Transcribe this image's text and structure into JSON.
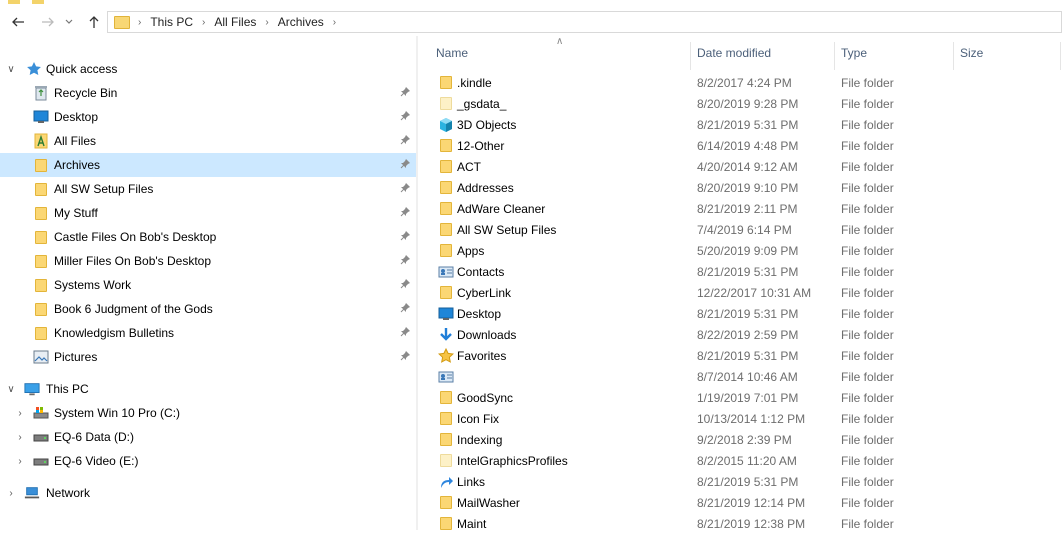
{
  "address": {
    "crumbs": [
      "This PC",
      "All Files",
      "Archives"
    ]
  },
  "nav": {
    "quick_access_label": "Quick access",
    "quick_items": [
      {
        "label": "Recycle Bin",
        "icon": "recycle-bin-icon"
      },
      {
        "label": "Desktop",
        "icon": "desktop-icon"
      },
      {
        "label": "All Files",
        "icon": "all-files-icon"
      },
      {
        "label": "Archives",
        "icon": "folder-icon"
      },
      {
        "label": "All SW Setup Files",
        "icon": "folder-icon"
      },
      {
        "label": "My Stuff",
        "icon": "folder-icon"
      },
      {
        "label": "Castle Files On Bob's Desktop",
        "icon": "folder-icon"
      },
      {
        "label": "Miller Files On Bob's Desktop",
        "icon": "folder-icon"
      },
      {
        "label": "Systems Work",
        "icon": "folder-icon"
      },
      {
        "label": "Book 6 Judgment of the Gods",
        "icon": "folder-icon"
      },
      {
        "label": "Knowledgism Bulletins",
        "icon": "folder-icon"
      },
      {
        "label": "Pictures",
        "icon": "pictures-icon"
      }
    ],
    "this_pc_label": "This PC",
    "drives": [
      {
        "label": "System Win 10 Pro (C:)",
        "icon": "system-drive-icon"
      },
      {
        "label": "EQ-6 Data (D:)",
        "icon": "drive-icon"
      },
      {
        "label": "EQ-6 Video (E:)",
        "icon": "drive-icon"
      }
    ],
    "network_label": "Network"
  },
  "columns": {
    "name": "Name",
    "date": "Date modified",
    "type": "Type",
    "size": "Size"
  },
  "files": [
    {
      "name": ".kindle",
      "date": "8/2/2017 4:24 PM",
      "type": "File folder",
      "icon": "folder-icon"
    },
    {
      "name": "_gsdata_",
      "date": "8/20/2019 9:28 PM",
      "type": "File folder",
      "icon": "pale-folder-icon"
    },
    {
      "name": "3D Objects",
      "date": "8/21/2019 5:31 PM",
      "type": "File folder",
      "icon": "3d-objects-icon"
    },
    {
      "name": "12-Other",
      "date": "6/14/2019 4:48 PM",
      "type": "File folder",
      "icon": "folder-icon"
    },
    {
      "name": "ACT",
      "date": "4/20/2014 9:12 AM",
      "type": "File folder",
      "icon": "folder-icon"
    },
    {
      "name": "Addresses",
      "date": "8/20/2019 9:10 PM",
      "type": "File folder",
      "icon": "folder-icon"
    },
    {
      "name": "AdWare Cleaner",
      "date": "8/21/2019 2:11 PM",
      "type": "File folder",
      "icon": "folder-icon"
    },
    {
      "name": "All SW Setup Files",
      "date": "7/4/2019 6:14 PM",
      "type": "File folder",
      "icon": "folder-icon"
    },
    {
      "name": "Apps",
      "date": "5/20/2019 9:09 PM",
      "type": "File folder",
      "icon": "folder-icon"
    },
    {
      "name": "Contacts",
      "date": "8/21/2019 5:31 PM",
      "type": "File folder",
      "icon": "contacts-icon"
    },
    {
      "name": "CyberLink",
      "date": "12/22/2017 10:31 AM",
      "type": "File folder",
      "icon": "folder-icon"
    },
    {
      "name": "Desktop",
      "date": "8/21/2019 5:31 PM",
      "type": "File folder",
      "icon": "desktop-icon"
    },
    {
      "name": "Downloads",
      "date": "8/22/2019 2:59 PM",
      "type": "File folder",
      "icon": "downloads-icon"
    },
    {
      "name": "Favorites",
      "date": "8/21/2019 5:31 PM",
      "type": "File folder",
      "icon": "favorites-icon"
    },
    {
      "name": "",
      "date": "8/7/2014 10:46 AM",
      "type": "File folder",
      "icon": "contacts-icon"
    },
    {
      "name": "GoodSync",
      "date": "1/19/2019 7:01 PM",
      "type": "File folder",
      "icon": "folder-icon"
    },
    {
      "name": "Icon Fix",
      "date": "10/13/2014 1:12 PM",
      "type": "File folder",
      "icon": "folder-icon"
    },
    {
      "name": "Indexing",
      "date": "9/2/2018 2:39 PM",
      "type": "File folder",
      "icon": "folder-icon"
    },
    {
      "name": "IntelGraphicsProfiles",
      "date": "8/2/2015 11:20 AM",
      "type": "File folder",
      "icon": "pale-folder-icon"
    },
    {
      "name": "Links",
      "date": "8/21/2019 5:31 PM",
      "type": "File folder",
      "icon": "links-icon"
    },
    {
      "name": "MailWasher",
      "date": "8/21/2019 12:14 PM",
      "type": "File folder",
      "icon": "folder-icon"
    },
    {
      "name": "Maint",
      "date": "8/21/2019 12:38 PM",
      "type": "File folder",
      "icon": "folder-icon"
    }
  ]
}
